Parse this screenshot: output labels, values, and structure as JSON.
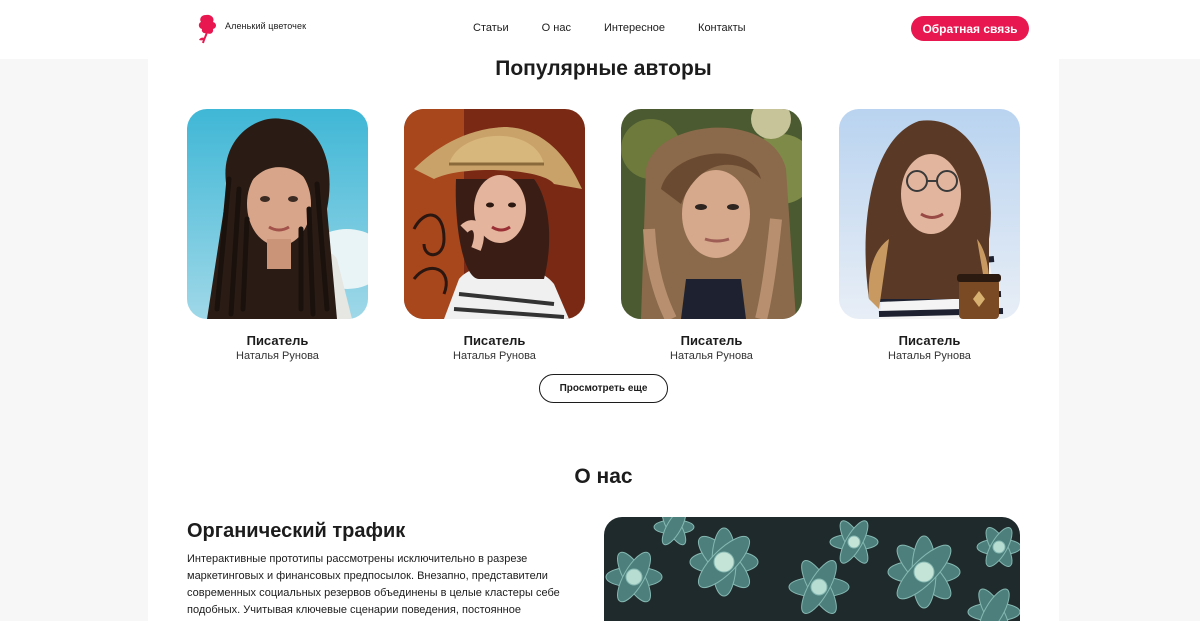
{
  "header": {
    "logo_text": "Аленький цветочек",
    "nav": [
      "Статьи",
      "О нас",
      "Интересное",
      "Контакты"
    ],
    "feedback_button": "Обратная связь"
  },
  "authors": {
    "title": "Популярные авторы",
    "items": [
      {
        "role": "Писатель",
        "name": "Наталья Рунова"
      },
      {
        "role": "Писатель",
        "name": "Наталья Рунова"
      },
      {
        "role": "Писатель",
        "name": "Наталья Рунова"
      },
      {
        "role": "Писатель",
        "name": "Наталья Рунова"
      }
    ],
    "more_button": "Просмотреть еще"
  },
  "about": {
    "title": "О нас",
    "heading": "Органический трафик",
    "text": "Интерактивные прототипы рассмотрены исключительно в разрезе маркетинговых и финансовых предпосылок. Внезапно, представители современных социальных резервов объединены в целые кластеры себе подобных. Учитывая ключевые сценарии поведения, постоянное"
  },
  "colors": {
    "accent": "#e8174f",
    "text": "#1c1c1c",
    "background": "#f7f7f7"
  }
}
